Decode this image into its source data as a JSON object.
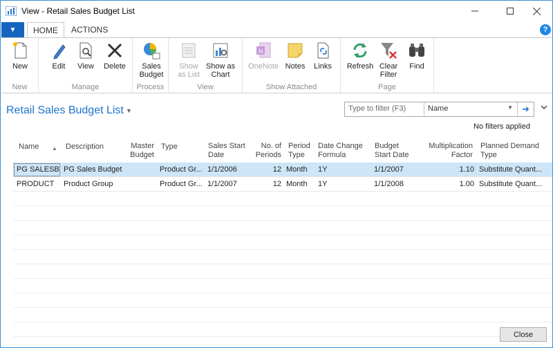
{
  "window": {
    "title": "View - Retail Sales Budget List"
  },
  "ribbon_tabs": {
    "home": "HOME",
    "actions": "ACTIONS"
  },
  "ribbon": {
    "groups": {
      "new": "New",
      "manage": "Manage",
      "process": "Process",
      "view": "View",
      "show_attached": "Show Attached",
      "page": "Page"
    },
    "buttons": {
      "new": "New",
      "edit": "Edit",
      "view": "View",
      "delete": "Delete",
      "sales_budget": "Sales Budget",
      "show_as_list": "Show as List",
      "show_as_chart": "Show as Chart",
      "onenote": "OneNote",
      "notes": "Notes",
      "links": "Links",
      "refresh": "Refresh",
      "clear_filter": "Clear Filter",
      "find": "Find"
    }
  },
  "page": {
    "title": "Retail Sales Budget List",
    "filter_placeholder": "Type to filter (F3)",
    "filter_field": "Name",
    "filter_status": "No filters applied"
  },
  "table": {
    "columns": {
      "name": "Name",
      "description": "Description",
      "master_budget_1": "Master",
      "master_budget_2": "Budget",
      "type": "Type",
      "sales_start_1": "Sales Start",
      "sales_start_2": "Date",
      "periods_1": "No. of",
      "periods_2": "Periods",
      "period_type_1": "Period",
      "period_type_2": "Type",
      "date_change_1": "Date Change",
      "date_change_2": "Formula",
      "budget_start_1": "Budget",
      "budget_start_2": "Start Date",
      "mult_1": "Multiplication",
      "mult_2": "Factor",
      "demand_1": "Planned Demand",
      "demand_2": "Type"
    },
    "rows": [
      {
        "name": "PG SALESB",
        "description": "PG Sales Budget",
        "master_budget": "",
        "type": "Product Gr...",
        "sales_start": "1/1/2006",
        "periods": "12",
        "period_type": "Month",
        "date_change": "1Y",
        "budget_start": "1/1/2007",
        "multiplication": "1.10",
        "demand_type": "Substitute Quant..."
      },
      {
        "name": "PRODUCT",
        "description": "Product Group",
        "master_budget": "",
        "type": "Product Gr...",
        "sales_start": "1/1/2007",
        "periods": "12",
        "period_type": "Month",
        "date_change": "1Y",
        "budget_start": "1/1/2008",
        "multiplication": "1.00",
        "demand_type": "Substitute Quant..."
      }
    ]
  },
  "footer": {
    "close": "Close"
  },
  "colors": {
    "accent": "#1e74c9",
    "selected_row": "#cde5f7",
    "file_tab": "#1565c0"
  }
}
